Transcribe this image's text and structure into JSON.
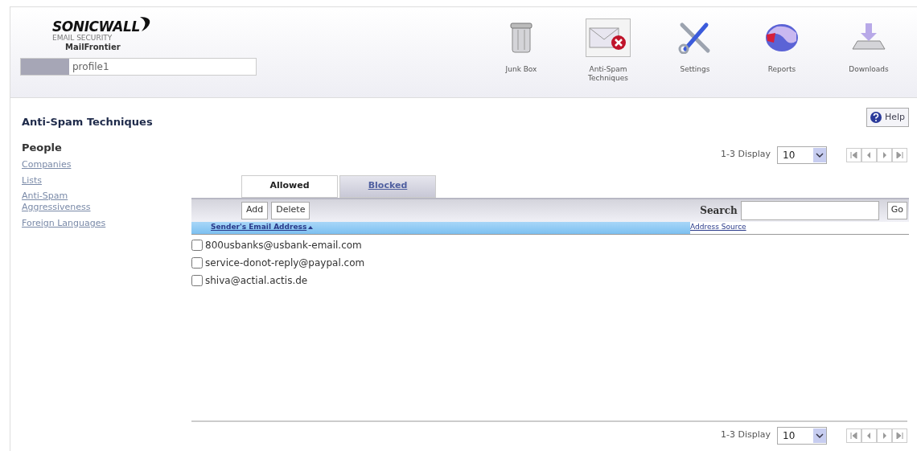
{
  "logo": {
    "brand": "SONICWALL",
    "subtitle": "EMAIL SECURITY",
    "product": "MailFrontier"
  },
  "profile": {
    "value": "profile1"
  },
  "nav": [
    {
      "label": "Junk Box",
      "kind": "trash",
      "selected": false
    },
    {
      "label": "Anti-Spam Techniques",
      "kind": "antispam",
      "selected": true
    },
    {
      "label": "Settings",
      "kind": "tools",
      "selected": false
    },
    {
      "label": "Reports",
      "kind": "reports",
      "selected": false
    },
    {
      "label": "Downloads",
      "kind": "download",
      "selected": false
    }
  ],
  "page_title": "Anti-Spam Techniques",
  "help": "Help",
  "sidebar": [
    {
      "label": "People",
      "selected": true
    },
    {
      "label": "Companies",
      "selected": false
    },
    {
      "label": "Lists",
      "selected": false
    },
    {
      "label": "Anti-Spam Aggressiveness",
      "selected": false
    },
    {
      "label": "Foreign Languages",
      "selected": false
    }
  ],
  "pager_top": {
    "range": "1-3 Display",
    "per_page": "10"
  },
  "tabs": [
    {
      "label": "Allowed",
      "selected": true
    },
    {
      "label": "Blocked",
      "selected": false
    }
  ],
  "toolbar": {
    "buttons": [
      "Add",
      "Delete"
    ],
    "search_label": "Search",
    "go": "Go"
  },
  "table": {
    "columns": [
      "Sender's Email Address",
      "Address Source"
    ],
    "rows": [
      {
        "email": "800usbanks@usbank-email.com",
        "checked": false
      },
      {
        "email": "service-donot-reply@paypal.com",
        "checked": false
      },
      {
        "email": "shiva@actial.actis.de",
        "checked": false
      }
    ]
  },
  "pager_bottom": {
    "range": "1-3 Display",
    "per_page": "10"
  }
}
